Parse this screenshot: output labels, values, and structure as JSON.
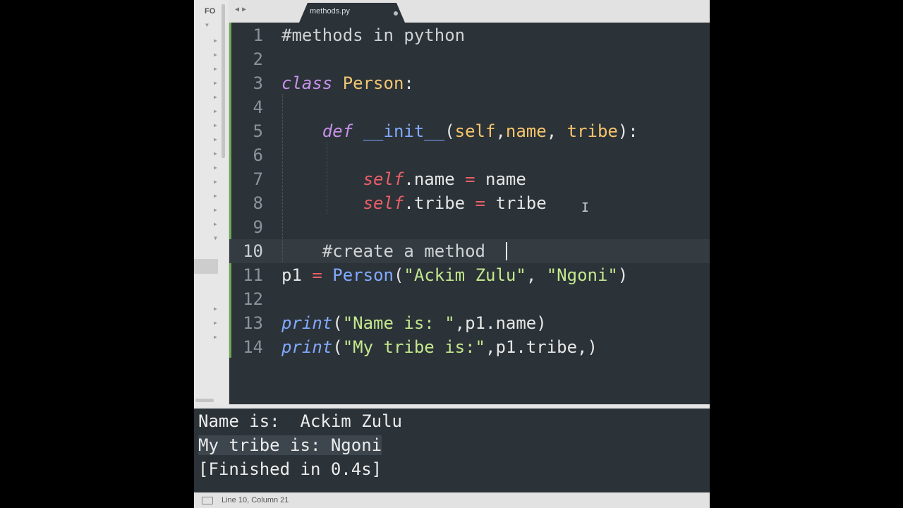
{
  "sidebar": {
    "folders_label": "FO"
  },
  "tab": {
    "file_name": "methods.py"
  },
  "editor": {
    "lines": [
      {
        "n": "1",
        "tokens": [
          {
            "c": "tk-comment",
            "t": "#methods in python"
          }
        ]
      },
      {
        "n": "2",
        "tokens": []
      },
      {
        "n": "3",
        "tokens": [
          {
            "c": "tk-kw",
            "t": "class"
          },
          {
            "c": "tk-plain",
            "t": " "
          },
          {
            "c": "tk-class",
            "t": "Person"
          },
          {
            "c": "tk-plain",
            "t": ":"
          }
        ]
      },
      {
        "n": "4",
        "tokens": []
      },
      {
        "n": "5",
        "tokens": [
          {
            "c": "tk-plain",
            "t": "    "
          },
          {
            "c": "tk-kw",
            "t": "def"
          },
          {
            "c": "tk-plain",
            "t": " "
          },
          {
            "c": "tk-func",
            "t": "__init__"
          },
          {
            "c": "tk-plain",
            "t": "("
          },
          {
            "c": "tk-param",
            "t": "self"
          },
          {
            "c": "tk-plain",
            "t": ","
          },
          {
            "c": "tk-param",
            "t": "name"
          },
          {
            "c": "tk-plain",
            "t": ", "
          },
          {
            "c": "tk-param",
            "t": "tribe"
          },
          {
            "c": "tk-plain",
            "t": "):"
          }
        ]
      },
      {
        "n": "6",
        "tokens": []
      },
      {
        "n": "7",
        "tokens": [
          {
            "c": "tk-plain",
            "t": "        "
          },
          {
            "c": "tk-self",
            "t": "self"
          },
          {
            "c": "tk-plain",
            "t": ".name "
          },
          {
            "c": "tk-op",
            "t": "="
          },
          {
            "c": "tk-plain",
            "t": " name"
          }
        ]
      },
      {
        "n": "8",
        "tokens": [
          {
            "c": "tk-plain",
            "t": "        "
          },
          {
            "c": "tk-self",
            "t": "self"
          },
          {
            "c": "tk-plain",
            "t": ".tribe "
          },
          {
            "c": "tk-op",
            "t": "="
          },
          {
            "c": "tk-plain",
            "t": " tribe"
          }
        ]
      },
      {
        "n": "9",
        "tokens": []
      },
      {
        "n": "10",
        "tokens": [
          {
            "c": "tk-comment",
            "t": "    #create a method"
          }
        ]
      },
      {
        "n": "11",
        "tokens": [
          {
            "c": "tk-plain",
            "t": "p1 "
          },
          {
            "c": "tk-op",
            "t": "="
          },
          {
            "c": "tk-plain",
            "t": " "
          },
          {
            "c": "tk-func",
            "t": "Person"
          },
          {
            "c": "tk-plain",
            "t": "("
          },
          {
            "c": "tk-str",
            "t": "\"Ackim Zulu\""
          },
          {
            "c": "tk-plain",
            "t": ", "
          },
          {
            "c": "tk-str",
            "t": "\"Ngoni\""
          },
          {
            "c": "tk-plain",
            "t": ")"
          }
        ]
      },
      {
        "n": "12",
        "tokens": []
      },
      {
        "n": "13",
        "tokens": [
          {
            "c": "tk-builtin",
            "t": "print"
          },
          {
            "c": "tk-plain",
            "t": "("
          },
          {
            "c": "tk-str",
            "t": "\"Name is: \""
          },
          {
            "c": "tk-plain",
            "t": ",p1.name)"
          }
        ]
      },
      {
        "n": "14",
        "tokens": [
          {
            "c": "tk-builtin",
            "t": "print"
          },
          {
            "c": "tk-plain",
            "t": "("
          },
          {
            "c": "tk-str",
            "t": "\"My tribe is:\""
          },
          {
            "c": "tk-plain",
            "t": ",p1.tribe,)"
          }
        ]
      }
    ]
  },
  "output": {
    "line1": "Name is:  Ackim Zulu",
    "line2": "My tribe is: Ngoni",
    "line3": "[Finished in 0.4s]"
  },
  "status": {
    "position": "Line 10, Column 21"
  }
}
